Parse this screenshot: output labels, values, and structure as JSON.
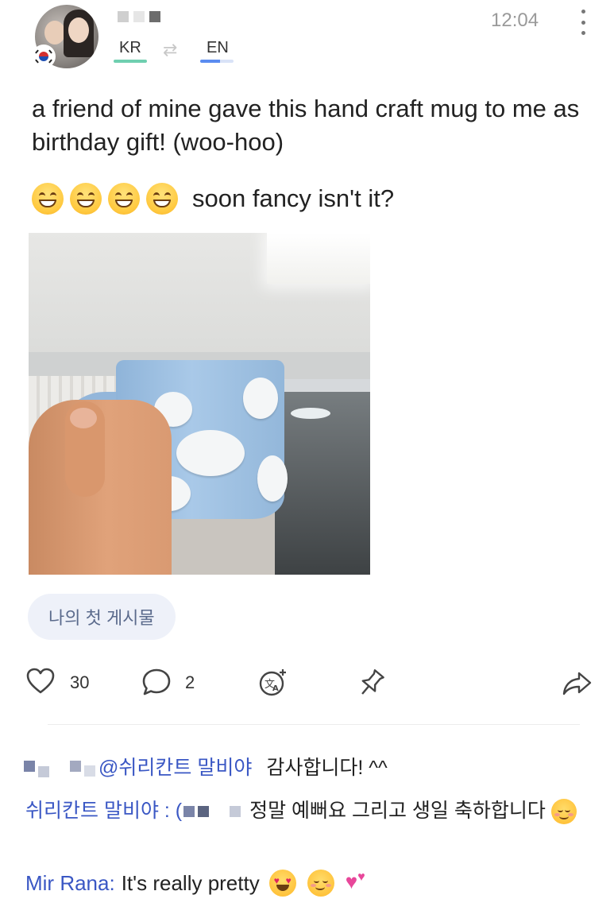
{
  "header": {
    "time": "12:04",
    "lang_from": "KR",
    "lang_to": "EN",
    "swap_icon": "swap-arrows-icon",
    "menu_icon": "kebab-menu-icon"
  },
  "post": {
    "text": "a friend of mine gave this hand craft mug to me as birthday gift! (woo-hoo)",
    "emoji_line_text": "soon fancy isn't it?",
    "tag": "나의 첫 게시물"
  },
  "actions": {
    "likes": "30",
    "comments": "2",
    "like_icon": "heart-icon",
    "comment_icon": "speech-bubble-icon",
    "translate_icon": "translate-icon",
    "pin_icon": "pin-icon",
    "share_icon": "share-arrow-icon"
  },
  "comments": [
    {
      "mention": "@쉬리칸트 말비야",
      "text": "감사합니다! ^^"
    },
    {
      "author": "쉬리칸트 말비야 : (",
      "text": "정말 예뻐요 그리고 생일 축하합니다"
    },
    {
      "author": "Mir Rana:",
      "text": "It's really pretty"
    }
  ],
  "colors": {
    "link_blue": "#3a57c4",
    "kr_underline": "#6fcfb0",
    "en_underline": "#5a8cf0",
    "tag_bg": "#eef1f9"
  }
}
